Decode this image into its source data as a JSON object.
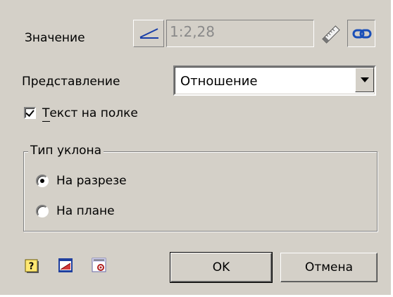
{
  "value_row": {
    "label": "Значение",
    "value": "1:2,28",
    "icons": [
      "slope-angle-icon",
      "ruler-icon",
      "link-icon"
    ]
  },
  "representation": {
    "label": "Представление",
    "selected": "Отношение"
  },
  "shelf_text": {
    "label": "Текст на полке",
    "checked": true
  },
  "slope_type": {
    "title": "Тип уклона",
    "options": [
      {
        "label": "На разрезе",
        "selected": true
      },
      {
        "label": "На плане",
        "selected": false
      }
    ]
  },
  "footer": {
    "ok_label": "OK",
    "cancel_label": "Отмена",
    "icons": [
      "help-icon",
      "template-icon",
      "settings-icon"
    ]
  }
}
